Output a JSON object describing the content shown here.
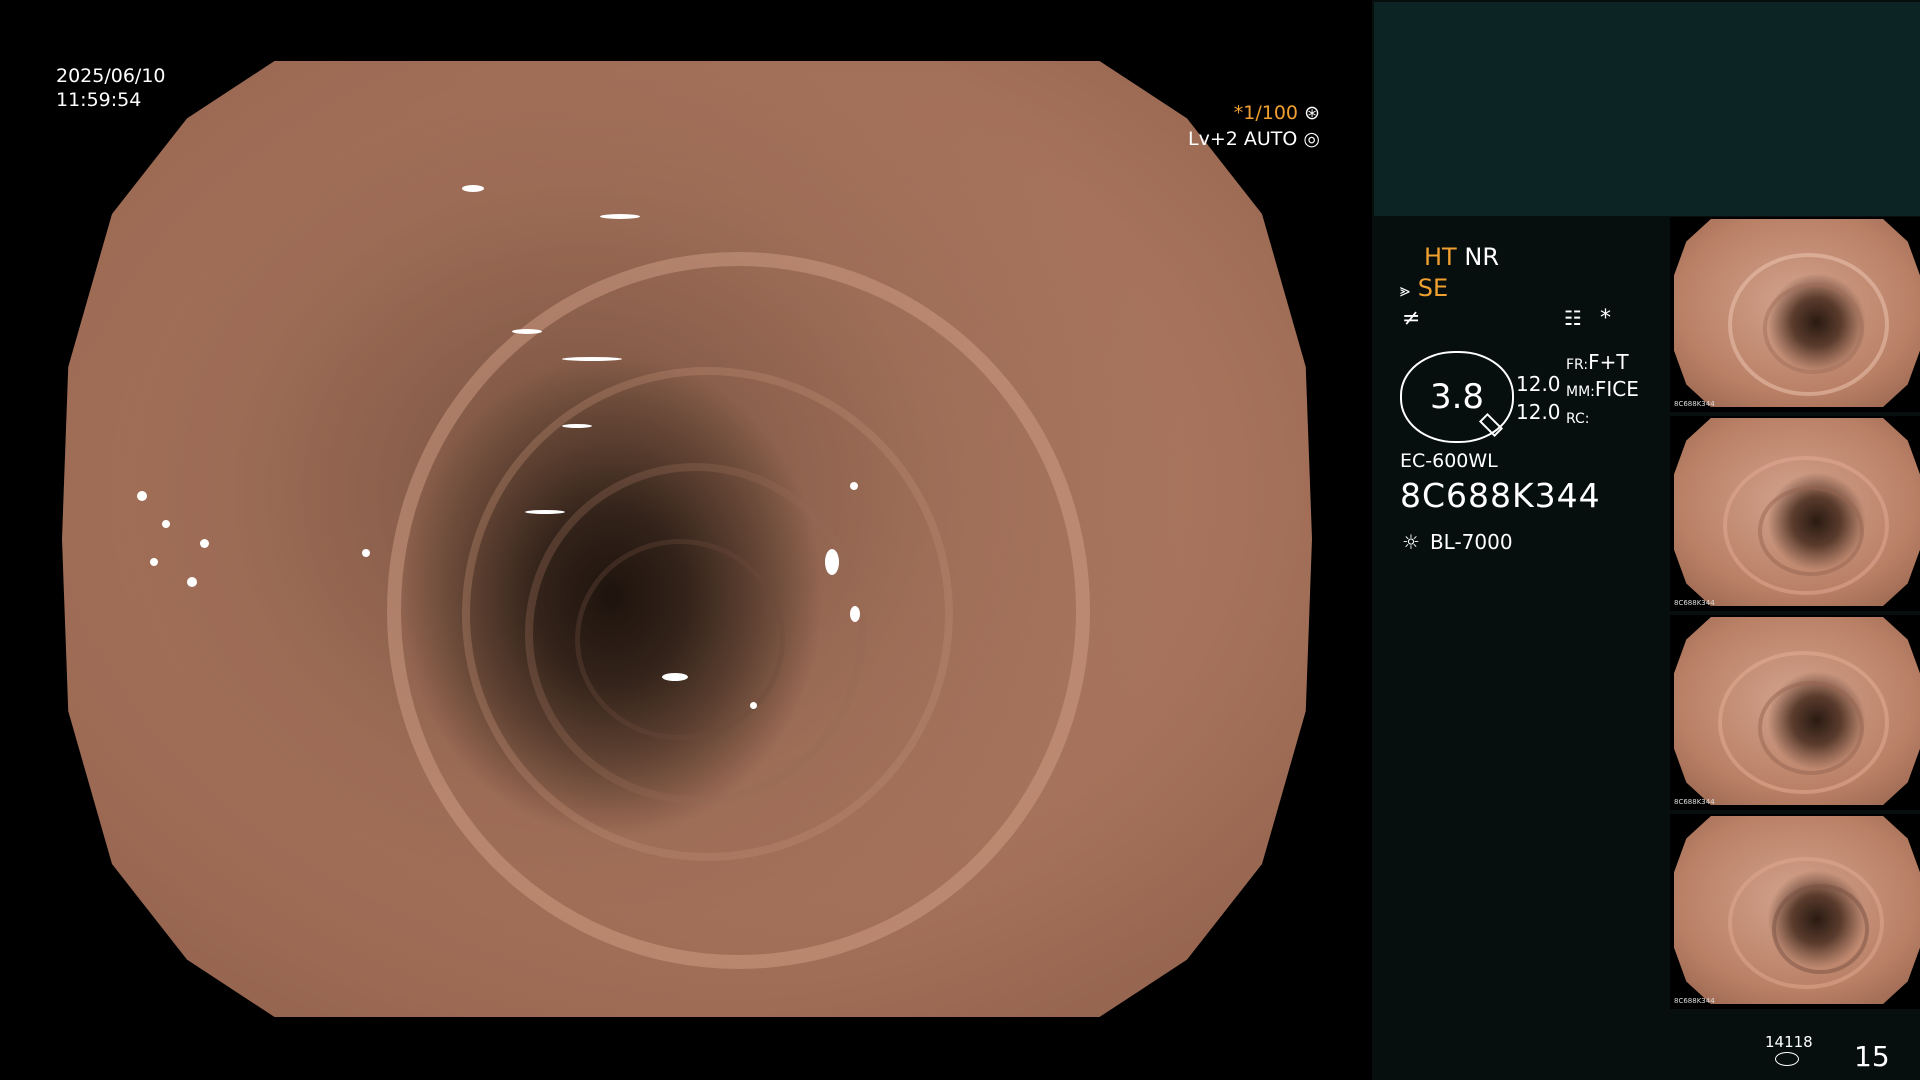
{
  "overlay": {
    "date": "2025/06/10",
    "time": "11:59:54",
    "shutter": "*1/100",
    "iris": "Lv+2 AUTO"
  },
  "panel": {
    "mode1": "HT",
    "mode2": "NR",
    "mode3": "SE",
    "asterisk": "*",
    "zoom": "3.8",
    "zoom_val1": "12.0",
    "zoom_val2": "12.0",
    "fr_label": "FR:",
    "fr_value": "F+T",
    "mm_label": "MM:",
    "mm_value": "FICE",
    "rc_label": "RC:",
    "scope_model": "EC-600WL",
    "serial": "8C688K344",
    "light_source": "BL-7000",
    "image_counter": "14118",
    "page_number": "15"
  },
  "thumbnails": [
    {
      "label": "8C688K344"
    },
    {
      "label": "8C688K344"
    },
    {
      "label": "8C688K344"
    },
    {
      "label": "8C688K344"
    }
  ],
  "colors": {
    "accent": "#f0a030",
    "panel_bg": "#060e0e",
    "panel_top": "#0c2424"
  }
}
